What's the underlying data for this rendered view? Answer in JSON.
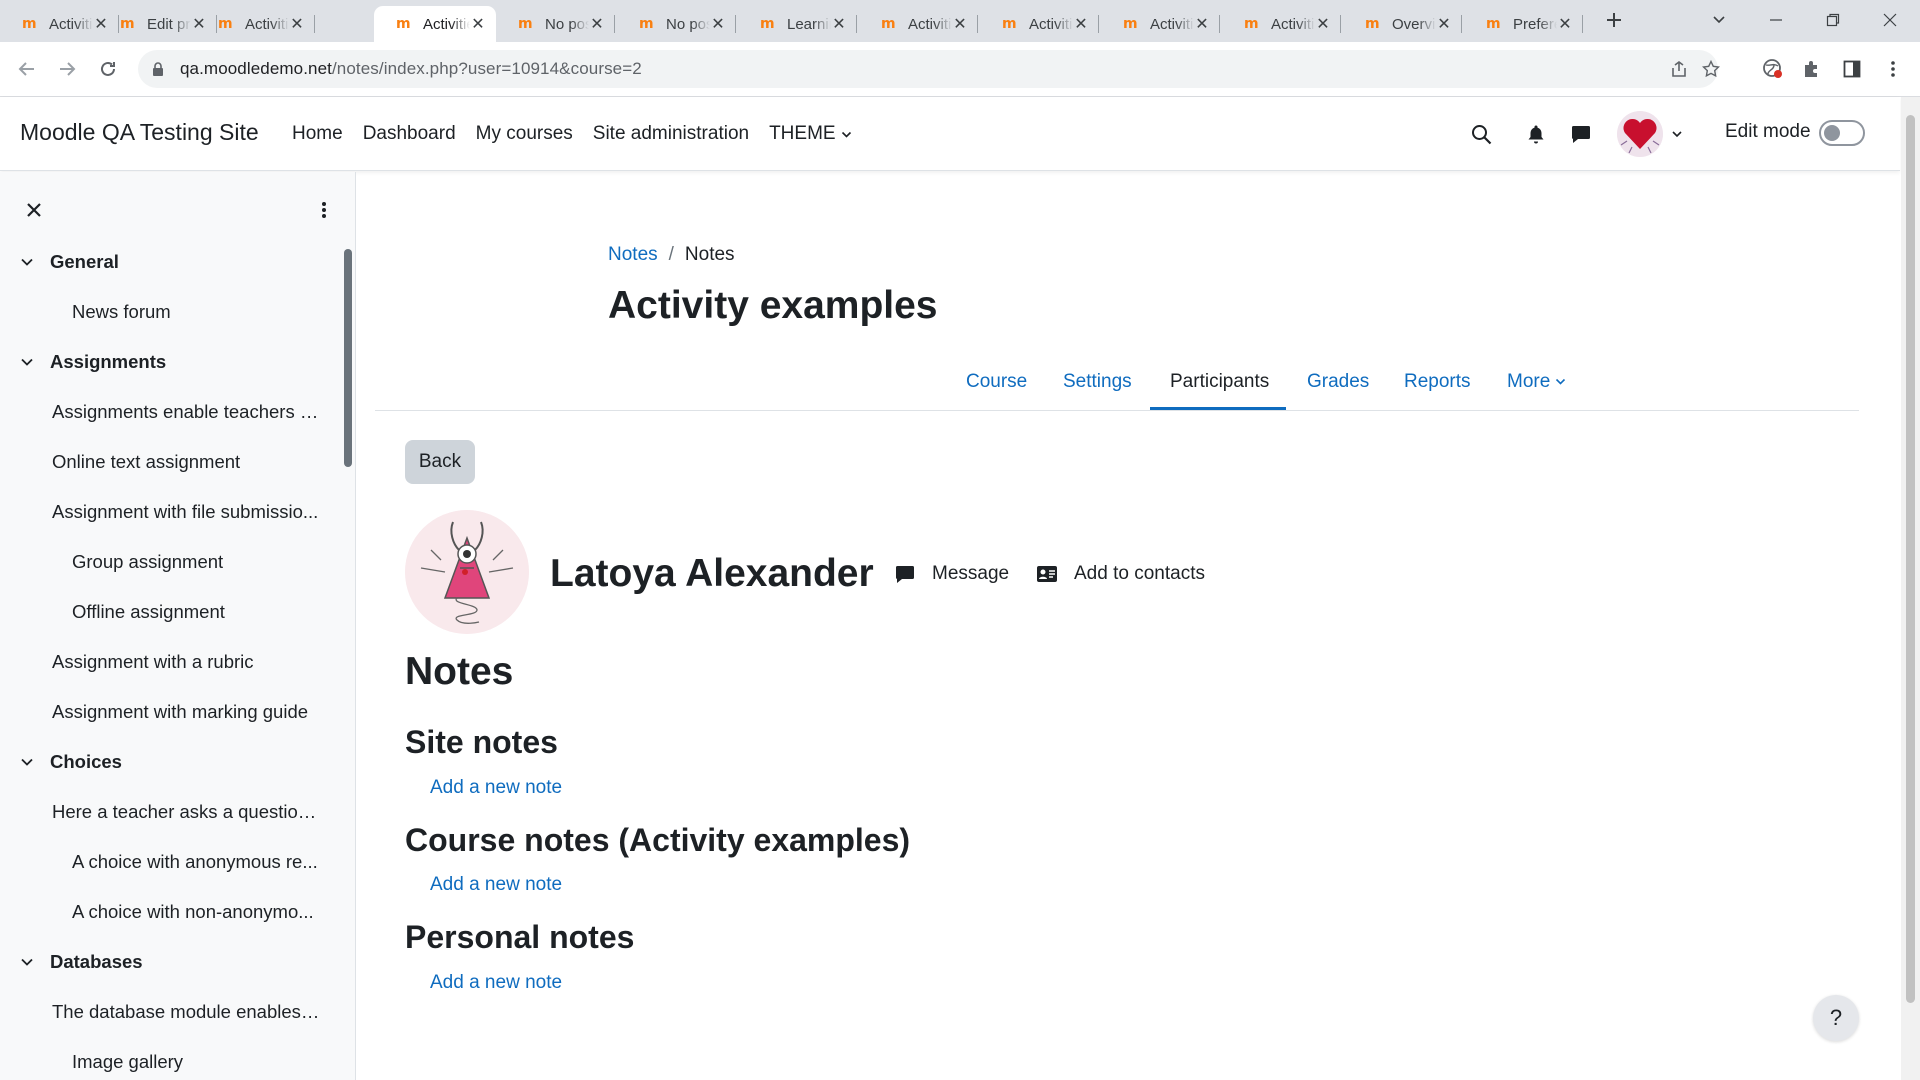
{
  "browser": {
    "tabs": [
      {
        "title": "Activities"
      },
      {
        "title": "Edit profile"
      },
      {
        "title": "Activities"
      },
      {
        "title": "Activities"
      },
      {
        "title": "No posts"
      },
      {
        "title": "No posts"
      },
      {
        "title": "Learning plans"
      },
      {
        "title": "Activities"
      },
      {
        "title": "Activities"
      },
      {
        "title": "Activities"
      },
      {
        "title": "Activities"
      },
      {
        "title": "Overview"
      },
      {
        "title": "Preferences"
      }
    ],
    "active_tab_index": 3,
    "url_host": "qa.moodledemo.net",
    "url_path": "/notes/index.php?user=10914&course=2"
  },
  "navbar": {
    "site_name": "Moodle QA Testing Site",
    "items": [
      "Home",
      "Dashboard",
      "My courses",
      "Site administration",
      "THEME"
    ],
    "edit_mode_label": "Edit mode"
  },
  "course_index": {
    "rows": [
      {
        "label": "General",
        "type": "section"
      },
      {
        "label": "News forum",
        "type": "l2"
      },
      {
        "label": "Assignments",
        "type": "section"
      },
      {
        "label": "Assignments enable teachers t...",
        "type": "l1"
      },
      {
        "label": "Online text assignment",
        "type": "l1"
      },
      {
        "label": "Assignment with file submissio...",
        "type": "l1"
      },
      {
        "label": "Group assignment",
        "type": "l2"
      },
      {
        "label": "Offline assignment",
        "type": "l2"
      },
      {
        "label": "Assignment with a rubric",
        "type": "l1"
      },
      {
        "label": "Assignment with marking guide",
        "type": "l1"
      },
      {
        "label": "Choices",
        "type": "section"
      },
      {
        "label": "Here a teacher asks a question...",
        "type": "l1"
      },
      {
        "label": "A choice with anonymous re...",
        "type": "l2"
      },
      {
        "label": "A choice with non-anonymo...",
        "type": "l2"
      },
      {
        "label": "Databases",
        "type": "section"
      },
      {
        "label": "The database module enables ...",
        "type": "l1"
      },
      {
        "label": "Image gallery",
        "type": "l2"
      }
    ]
  },
  "main": {
    "breadcrumb": [
      "Notes",
      "Notes"
    ],
    "page_title": "Activity examples",
    "secondary_nav": [
      "Course",
      "Settings",
      "Participants",
      "Grades",
      "Reports",
      "More"
    ],
    "active_secondary": "Participants",
    "back_label": "Back",
    "user_name": "Latoya Alexander",
    "message_label": "Message",
    "add_contacts_label": "Add to contacts",
    "notes_heading": "Notes",
    "sections": [
      {
        "heading": "Site notes",
        "link": "Add a new note"
      },
      {
        "heading": "Course notes (Activity examples)",
        "link": "Add a new note"
      },
      {
        "heading": "Personal notes",
        "link": "Add a new note"
      }
    ],
    "help_label": "?"
  },
  "colors": {
    "link": "#0f6cbf",
    "text": "#1d2125",
    "moodle_orange": "#f98012",
    "drawer_bg": "#f8f9fa"
  }
}
